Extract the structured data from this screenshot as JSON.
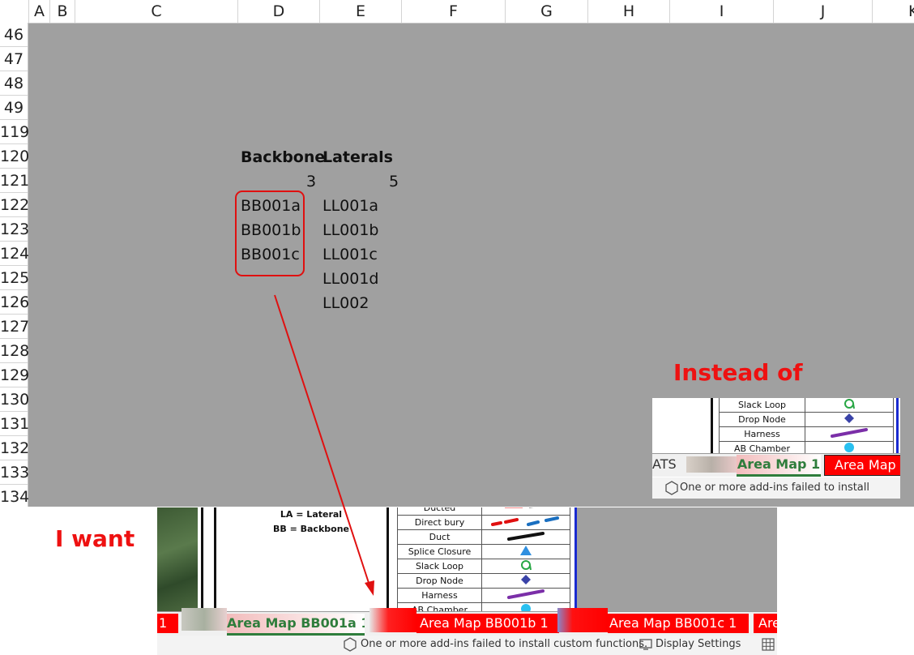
{
  "columns": [
    "A",
    "B",
    "C",
    "D",
    "E",
    "F",
    "G",
    "H",
    "I",
    "J",
    "K"
  ],
  "rows": [
    "46",
    "47",
    "48",
    "49",
    "119",
    "120",
    "121",
    "122",
    "123",
    "124",
    "125",
    "126",
    "127",
    "128",
    "129",
    "130",
    "131",
    "132",
    "133",
    "134"
  ],
  "sheet": {
    "backbone_header": "Backbone",
    "laterals_header": "Laterals",
    "backbone_count": "3",
    "laterals_count": "5",
    "backbone_items": [
      "BB001a",
      "BB001b",
      "BB001c"
    ],
    "lateral_items": [
      "LL001a",
      "LL001b",
      "LL001c",
      "LL001d",
      "LL002"
    ]
  },
  "annotations": {
    "instead_of": "Instead of",
    "i_want": "I want",
    "accent_color": "#ee1111"
  },
  "instead_panel": {
    "legend": [
      {
        "label": "Slack Loop",
        "symbol": "slack-loop-icon"
      },
      {
        "label": "Drop Node",
        "symbol": "diamond-icon"
      },
      {
        "label": "Harness",
        "symbol": "purple-line-icon"
      },
      {
        "label": "AB Chamber",
        "symbol": "blue-circle-icon"
      }
    ],
    "tab_prefix": "ATS",
    "tab_active": "Area Map 1",
    "tab_next": "Area Map",
    "status_message": "One or more add-ins failed to install custom fu"
  },
  "want_panel": {
    "key_line1": "LA = Lateral",
    "key_line2": "BB = Backbone",
    "legend": [
      {
        "label": "Ducted",
        "symbol": "ducted-line-icon"
      },
      {
        "label": "Direct bury",
        "symbol": "dashed-line-icon"
      },
      {
        "label": "Duct",
        "symbol": "black-line-icon"
      },
      {
        "label": "Splice Closure",
        "symbol": "triangle-icon"
      },
      {
        "label": "Slack Loop",
        "symbol": "slack-loop-icon"
      },
      {
        "label": "Drop Node",
        "symbol": "diamond-icon"
      },
      {
        "label": "Harness",
        "symbol": "purple-line-icon"
      },
      {
        "label": "AB Chamber",
        "symbol": "blue-circle-icon"
      }
    ],
    "tab_first_fragment": "1",
    "tab_active": "Area Map BB001a 1",
    "tab_2": "Area Map BB001b 1",
    "tab_3": "Area Map BB001c 1",
    "tab_4_fragment": "Are",
    "status_message": "One or more add-ins failed to install custom functions.",
    "display_settings": "Display Settings"
  },
  "colors": {
    "sheet_grey": "#a0a0a0",
    "tab_red": "#ff0000",
    "active_tab_text": "#2f7d3c"
  }
}
